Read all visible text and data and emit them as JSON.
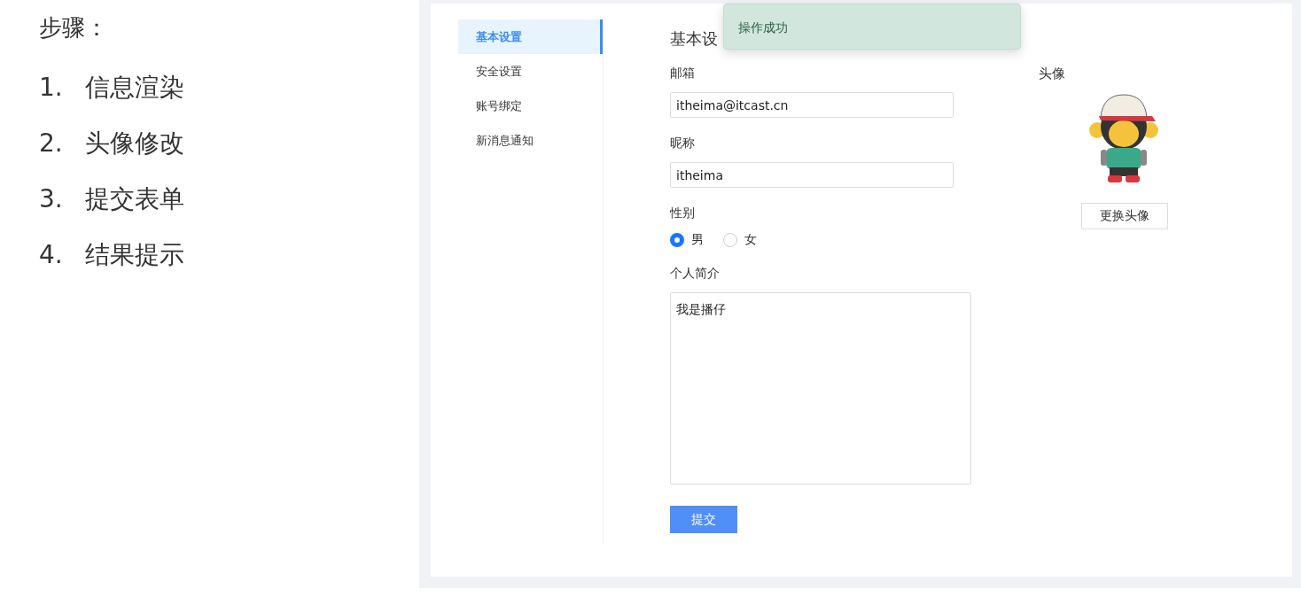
{
  "slide": {
    "heading": "步骤：",
    "steps": [
      {
        "number": "1.",
        "text": "信息渲染"
      },
      {
        "number": "2.",
        "text": "头像修改"
      },
      {
        "number": "3.",
        "text": "提交表单"
      },
      {
        "number": "4.",
        "text": "结果提示"
      }
    ]
  },
  "app": {
    "sidebar": {
      "items": [
        {
          "label": "基本设置",
          "selected": true
        },
        {
          "label": "安全设置",
          "selected": false
        },
        {
          "label": "账号绑定",
          "selected": false
        },
        {
          "label": "新消息通知",
          "selected": false
        }
      ]
    },
    "page_title": "基本设",
    "form": {
      "fields": [
        {
          "kind": "text",
          "label": "邮箱",
          "value": "itheima@itcast.cn"
        },
        {
          "kind": "text",
          "label": "昵称",
          "value": "itheima"
        },
        {
          "kind": "radio",
          "label": "性别",
          "options": [
            {
              "label": "男",
              "selected": true
            },
            {
              "label": "女",
              "selected": false
            }
          ]
        },
        {
          "kind": "textarea",
          "label": "个人简介",
          "value": "我是播仔"
        }
      ],
      "submit": "提交"
    },
    "avatar": {
      "label": "头像",
      "button": "更换头像"
    },
    "toast": {
      "message": "操作成功"
    }
  }
}
